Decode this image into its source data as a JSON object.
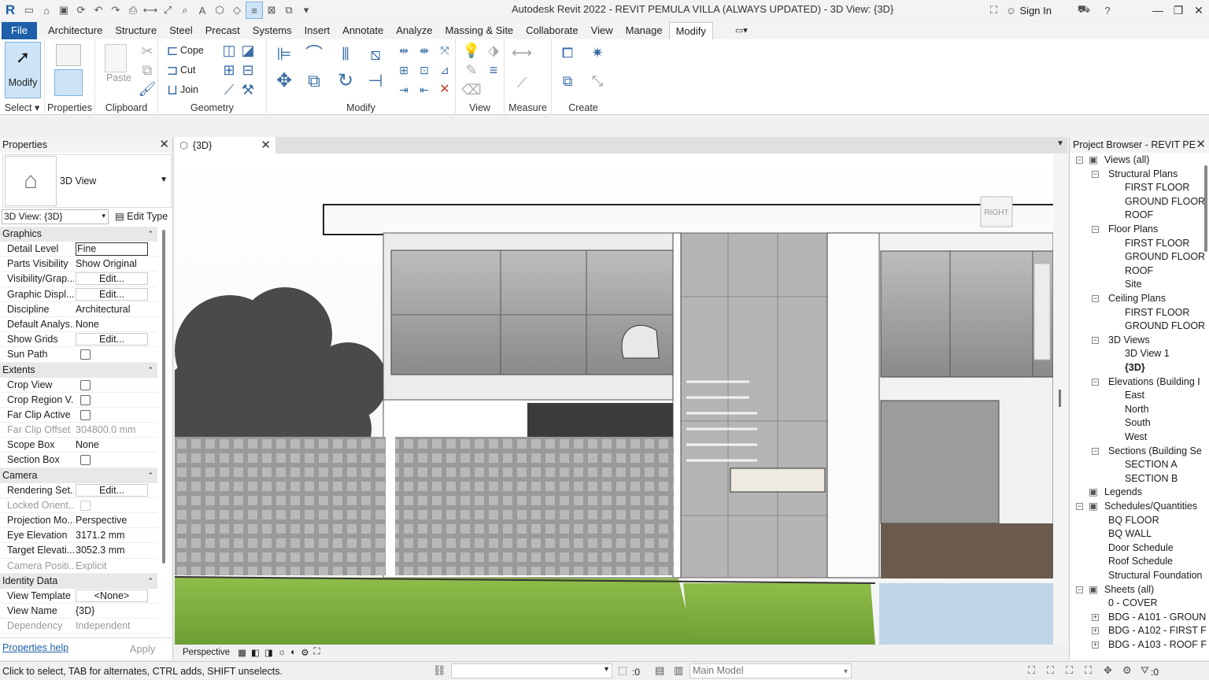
{
  "window": {
    "title": "Autodesk Revit 2022 - REVIT PEMULA VILLA (ALWAYS UPDATED) - 3D View: {3D}",
    "sign_in": "Sign In"
  },
  "menu": {
    "file": "File",
    "tabs": [
      "Architecture",
      "Structure",
      "Steel",
      "Precast",
      "Systems",
      "Insert",
      "Annotate",
      "Analyze",
      "Massing & Site",
      "Collaborate",
      "View",
      "Manage",
      "Modify"
    ]
  },
  "ribbon": {
    "select": "Select",
    "modify": "Modify",
    "properties": "Properties",
    "paste": "Paste",
    "clipboard": "Clipboard",
    "cope": "Cope",
    "cut": "Cut",
    "join": "Join",
    "geometry": "Geometry",
    "modify_panel": "Modify",
    "view": "View",
    "measure": "Measure",
    "create": "Create"
  },
  "properties": {
    "header": "Properties",
    "type_name": "3D View",
    "view_selector": "3D View: {3D}",
    "edit_type": "Edit Type",
    "sections": [
      {
        "title": "Graphics",
        "rows": [
          {
            "k": "Detail Level",
            "v": "Fine",
            "kind": "input"
          },
          {
            "k": "Parts Visibility",
            "v": "Show Original",
            "kind": "text"
          },
          {
            "k": "Visibility/Grap...",
            "v": "Edit...",
            "kind": "button"
          },
          {
            "k": "Graphic Displ...",
            "v": "Edit...",
            "kind": "button"
          },
          {
            "k": "Discipline",
            "v": "Architectural",
            "kind": "text"
          },
          {
            "k": "Default Analys...",
            "v": "None",
            "kind": "text"
          },
          {
            "k": "Show Grids",
            "v": "Edit...",
            "kind": "button"
          },
          {
            "k": "Sun Path",
            "v": "",
            "kind": "check"
          }
        ]
      },
      {
        "title": "Extents",
        "rows": [
          {
            "k": "Crop View",
            "v": "",
            "kind": "check"
          },
          {
            "k": "Crop Region V...",
            "v": "",
            "kind": "check"
          },
          {
            "k": "Far Clip Active",
            "v": "",
            "kind": "check"
          },
          {
            "k": "Far Clip Offset",
            "v": "304800.0 mm",
            "kind": "dim"
          },
          {
            "k": "Scope Box",
            "v": "None",
            "kind": "text"
          },
          {
            "k": "Section Box",
            "v": "",
            "kind": "check"
          }
        ]
      },
      {
        "title": "Camera",
        "rows": [
          {
            "k": "Rendering Set...",
            "v": "Edit...",
            "kind": "button"
          },
          {
            "k": "Locked Orient...",
            "v": "",
            "kind": "dimcheck"
          },
          {
            "k": "Projection Mo...",
            "v": "Perspective",
            "kind": "text"
          },
          {
            "k": "Eye Elevation",
            "v": "3171.2 mm",
            "kind": "text"
          },
          {
            "k": "Target Elevati...",
            "v": "3052.3 mm",
            "kind": "text"
          },
          {
            "k": "Camera Positi...",
            "v": "Explicit",
            "kind": "dim"
          }
        ]
      },
      {
        "title": "Identity Data",
        "rows": [
          {
            "k": "View Template",
            "v": "<None>",
            "kind": "button"
          },
          {
            "k": "View Name",
            "v": "{3D}",
            "kind": "text"
          },
          {
            "k": "Dependency",
            "v": "Independent",
            "kind": "dim"
          }
        ]
      }
    ],
    "help": "Properties help",
    "apply": "Apply"
  },
  "view": {
    "tab_label": "{3D}",
    "viewcube_label": "RIGHT",
    "projection": "Perspective"
  },
  "browser": {
    "header": "Project Browser - REVIT PE...",
    "nodes": [
      {
        "label": "Views (all)",
        "level": 0,
        "toggle": "-",
        "icon": true
      },
      {
        "label": "Structural Plans",
        "level": 1,
        "toggle": "-"
      },
      {
        "label": "FIRST FLOOR",
        "level": 2
      },
      {
        "label": "GROUND FLOOR",
        "level": 2
      },
      {
        "label": "ROOF",
        "level": 2
      },
      {
        "label": "Floor Plans",
        "level": 1,
        "toggle": "-"
      },
      {
        "label": "FIRST FLOOR",
        "level": 2
      },
      {
        "label": "GROUND FLOOR",
        "level": 2
      },
      {
        "label": "ROOF",
        "level": 2
      },
      {
        "label": "Site",
        "level": 2
      },
      {
        "label": "Ceiling Plans",
        "level": 1,
        "toggle": "-"
      },
      {
        "label": "FIRST FLOOR",
        "level": 2
      },
      {
        "label": "GROUND FLOOR",
        "level": 2
      },
      {
        "label": "3D Views",
        "level": 1,
        "toggle": "-"
      },
      {
        "label": "3D View 1",
        "level": 2
      },
      {
        "label": "{3D}",
        "level": 2,
        "bold": true
      },
      {
        "label": "Elevations (Building I",
        "level": 1,
        "toggle": "-"
      },
      {
        "label": "East",
        "level": 2
      },
      {
        "label": "North",
        "level": 2
      },
      {
        "label": "South",
        "level": 2
      },
      {
        "label": "West",
        "level": 2
      },
      {
        "label": "Sections (Building Se",
        "level": 1,
        "toggle": "-"
      },
      {
        "label": "SECTION A",
        "level": 2
      },
      {
        "label": "SECTION B",
        "level": 2
      },
      {
        "label": "Legends",
        "level": 0,
        "icon": true
      },
      {
        "label": "Schedules/Quantities",
        "level": 0,
        "toggle": "-",
        "icon": true
      },
      {
        "label": "BQ FLOOR",
        "level": 1
      },
      {
        "label": "BQ WALL",
        "level": 1
      },
      {
        "label": "Door Schedule",
        "level": 1
      },
      {
        "label": "Roof Schedule",
        "level": 1
      },
      {
        "label": "Structural Foundation",
        "level": 1
      },
      {
        "label": "Sheets (all)",
        "level": 0,
        "toggle": "-",
        "icon": true
      },
      {
        "label": "0 - COVER",
        "level": 1
      },
      {
        "label": "BDG - A101 - GROUN",
        "level": 1,
        "toggle": "+"
      },
      {
        "label": "BDG - A102 - FIRST F",
        "level": 1,
        "toggle": "+"
      },
      {
        "label": "BDG - A103 - ROOF F",
        "level": 1,
        "toggle": "+"
      }
    ]
  },
  "status": {
    "hint": "Click to select, TAB for alternates, CTRL adds, SHIFT unselects.",
    "count_left": ":0",
    "model": "Main Model",
    "filter_count": ":0"
  }
}
